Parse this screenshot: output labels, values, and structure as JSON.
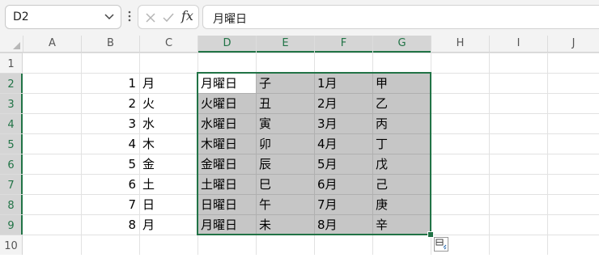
{
  "namebox": {
    "value": "D2"
  },
  "formula_bar": {
    "fx_label": "fx",
    "content": "月曜日"
  },
  "columns": [
    "A",
    "B",
    "C",
    "D",
    "E",
    "F",
    "G",
    "H",
    "I",
    "J"
  ],
  "selected_columns": [
    "D",
    "E",
    "F",
    "G"
  ],
  "rows": [
    "1",
    "2",
    "3",
    "4",
    "5",
    "6",
    "7",
    "8",
    "9",
    "10"
  ],
  "selected_rows": [
    "2",
    "3",
    "4",
    "5",
    "6",
    "7",
    "8",
    "9"
  ],
  "active_cell": "D2",
  "selection_range": "D2:G9",
  "data": [
    {
      "b": "1",
      "c": "月",
      "d": "月曜日",
      "e": "子",
      "f": "1月",
      "g": "甲"
    },
    {
      "b": "2",
      "c": "火",
      "d": "火曜日",
      "e": "丑",
      "f": "2月",
      "g": "乙"
    },
    {
      "b": "3",
      "c": "水",
      "d": "水曜日",
      "e": "寅",
      "f": "3月",
      "g": "丙"
    },
    {
      "b": "4",
      "c": "木",
      "d": "木曜日",
      "e": "卯",
      "f": "4月",
      "g": "丁"
    },
    {
      "b": "5",
      "c": "金",
      "d": "金曜日",
      "e": "辰",
      "f": "5月",
      "g": "戊"
    },
    {
      "b": "6",
      "c": "土",
      "d": "土曜日",
      "e": "巳",
      "f": "6月",
      "g": "己"
    },
    {
      "b": "7",
      "c": "日",
      "d": "日曜日",
      "e": "午",
      "f": "7月",
      "g": "庚"
    },
    {
      "b": "8",
      "c": "月",
      "d": "月曜日",
      "e": "未",
      "f": "8月",
      "g": "辛"
    }
  ],
  "colors": {
    "accent": "#217346",
    "selection_fill": "#c6c6c6"
  },
  "icons": [
    "chevron-down-icon",
    "more-options-icon",
    "cancel-icon",
    "enter-icon",
    "quick-analysis-icon"
  ]
}
